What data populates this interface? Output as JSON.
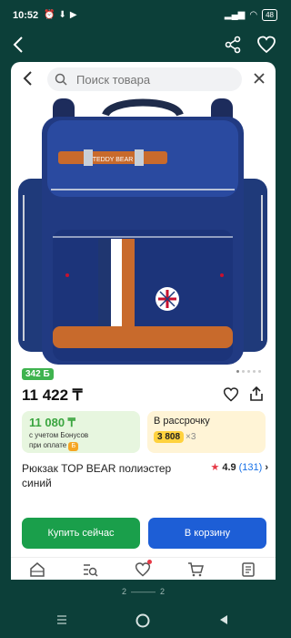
{
  "status_bar": {
    "time": "10:52",
    "battery": "48"
  },
  "search": {
    "placeholder": "Поиск товара"
  },
  "product": {
    "bonus_badge": "342 Б",
    "price": "11 422 ₸",
    "bonus_card": {
      "amount": "11 080 ₸",
      "line1": "с учетом Бонусов",
      "line2": "при оплате",
      "coin": "Б"
    },
    "installment": {
      "label": "В рассрочку",
      "amount": "3 808",
      "multiplier": "×3"
    },
    "title": "Рюкзак TOP BEAR полиэстер синий",
    "rating": {
      "value": "4.9",
      "count": "(131)"
    },
    "brand_label": "TEDDY BEAR"
  },
  "buttons": {
    "buy_now": "Купить сейчас",
    "add_to_cart": "В корзину"
  },
  "pager": {
    "left": "2",
    "right": "2"
  },
  "colors": {
    "background": "#0c3f39",
    "buy": "#1a9f4b",
    "cart": "#1d5ed6",
    "bonus_green": "#3aa53f",
    "rating_star": "#e63946"
  },
  "icons": [
    "back-arrow-icon",
    "share-icon",
    "heart-icon",
    "search-icon",
    "close-icon",
    "home-icon",
    "catalog-icon",
    "favorites-icon",
    "cart-icon",
    "orders-icon"
  ]
}
